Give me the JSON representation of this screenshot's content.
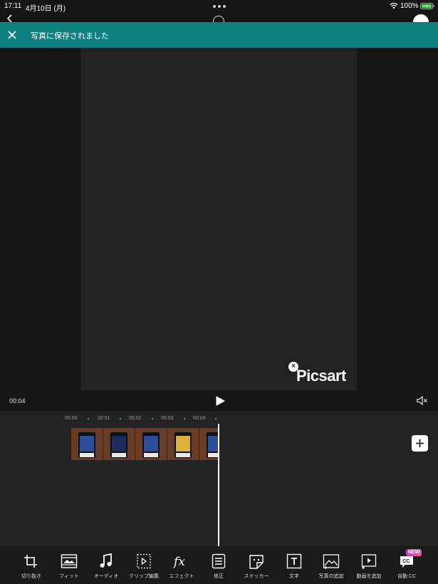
{
  "status_bar": {
    "time": "17:11",
    "date": "4月10日 (月)",
    "battery": "100%"
  },
  "toast": {
    "message": "写真に保存されました"
  },
  "preview": {
    "watermark": "Picsart",
    "watermark_close": "×",
    "time": "00:04"
  },
  "timeline": {
    "ruler": [
      "00:00",
      "00:01",
      "00:02",
      "00:03",
      "00:04"
    ]
  },
  "toolbar": {
    "items": [
      {
        "label": "切り抜き",
        "icon": "crop-icon"
      },
      {
        "label": "フィット",
        "icon": "fit-icon"
      },
      {
        "label": "オーディオ",
        "icon": "music-note-icon"
      },
      {
        "label": "クリップ編集",
        "icon": "clip-edit-icon"
      },
      {
        "label": "エフェクト",
        "icon": "fx-icon"
      },
      {
        "label": "修正",
        "icon": "adjust-icon"
      },
      {
        "label": "ステッカー",
        "icon": "sticker-icon"
      },
      {
        "label": "文字",
        "icon": "text-icon"
      },
      {
        "label": "写真の追加",
        "icon": "add-photo-icon"
      },
      {
        "label": "動画を追加",
        "icon": "add-video-icon"
      },
      {
        "label": "自動 CC",
        "icon": "auto-cc-icon"
      }
    ],
    "new_badge": "NEW"
  }
}
